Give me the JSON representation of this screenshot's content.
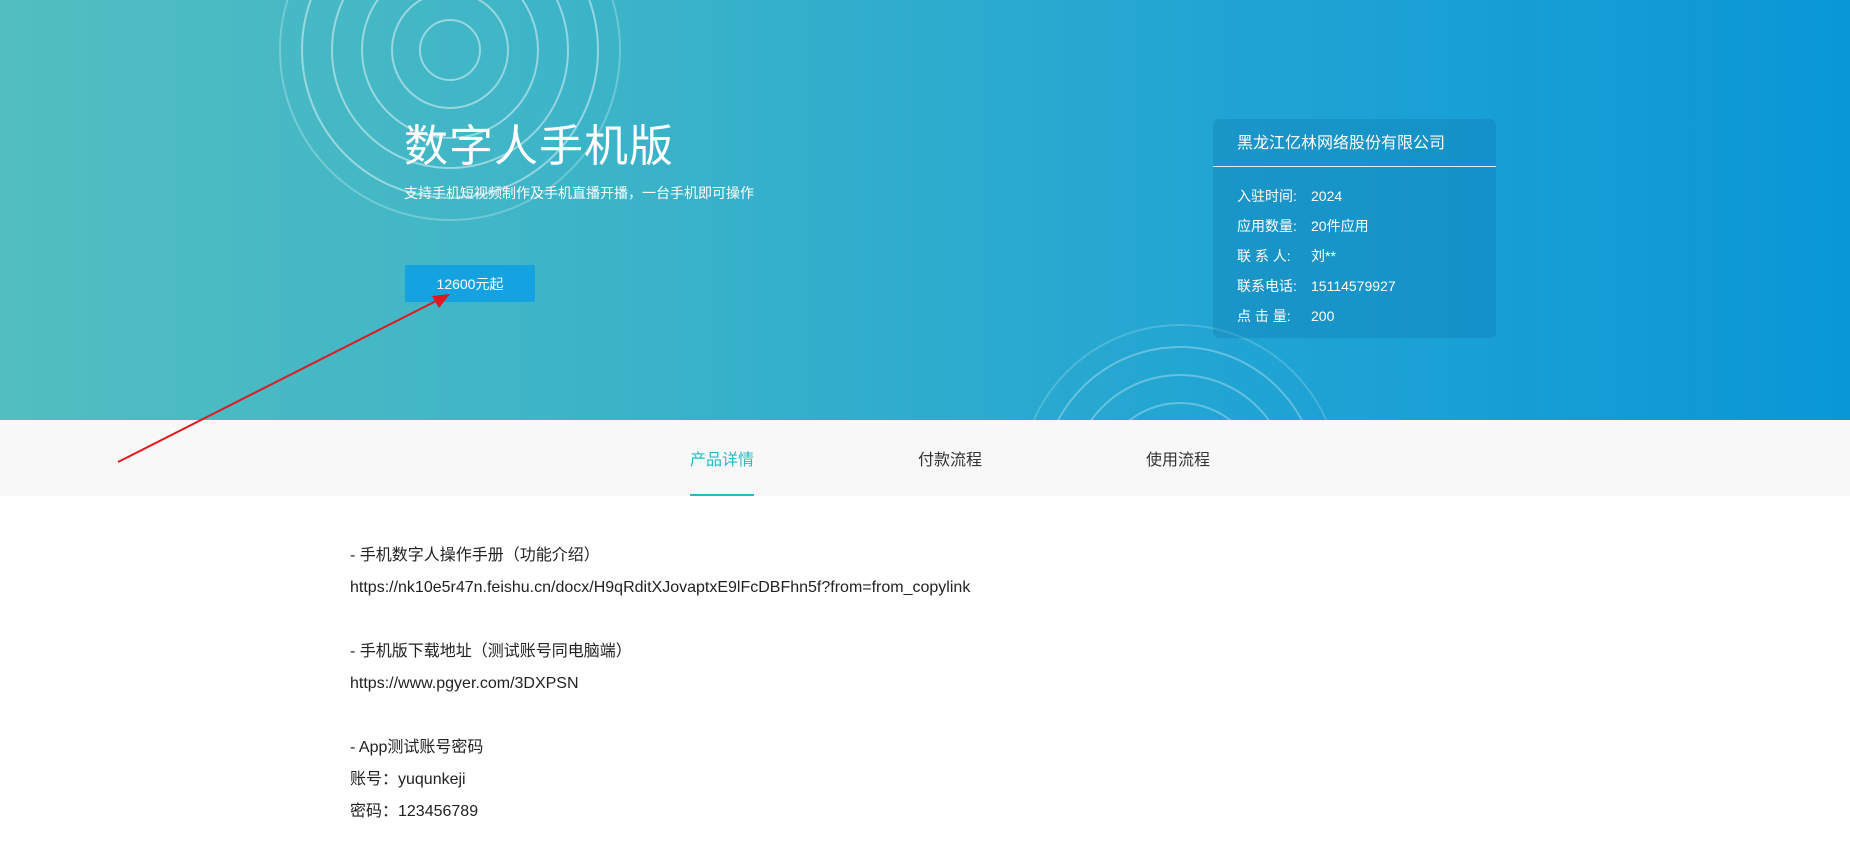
{
  "hero": {
    "title": "数字人手机版",
    "subtitle": "支持手机短视频制作及手机直播开播，一台手机即可操作",
    "price_button": "12600元起"
  },
  "company": {
    "name": "黑龙江亿林网络股份有限公司",
    "rows": [
      {
        "label": "入驻时间:",
        "value": "2024"
      },
      {
        "label": "应用数量:",
        "value": "20件应用"
      },
      {
        "label": "联 系 人:",
        "value": "刘**"
      },
      {
        "label": "联系电话:",
        "value": "15114579927"
      },
      {
        "label": "点 击 量:",
        "value": "200"
      }
    ]
  },
  "tabs": [
    {
      "label": "产品详情",
      "active": true
    },
    {
      "label": "付款流程",
      "active": false
    },
    {
      "label": "使用流程",
      "active": false
    }
  ],
  "content": {
    "manual_heading": "- 手机数字人操作手册（功能介绍）",
    "manual_link": "https://nk10e5r47n.feishu.cn/docx/H9qRditXJovaptxE9lFcDBFhn5f?from=from_copylink",
    "download_heading": "- 手机版下载地址（测试账号同电脑端）",
    "download_link": "https://www.pgyer.com/3DXPSN",
    "account_heading": "- App测试账号密码",
    "account_line": "账号：yuqunkeji",
    "password_line": "密码：123456789"
  },
  "colors": {
    "hero_start": "#52bec0",
    "hero_end": "#0a97d6",
    "accent": "#2bb8c6",
    "button": "#14a3e0",
    "annotation": "#e0191f"
  }
}
